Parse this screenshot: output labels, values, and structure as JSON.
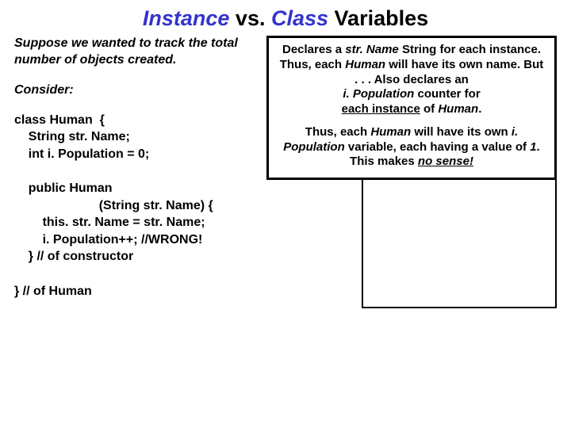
{
  "title": {
    "instance": "Instance",
    "vs": " vs. ",
    "class": "Class",
    "variables": " Variables"
  },
  "left": {
    "intro": "Suppose we wanted to track the total number of objects created.",
    "consider": "Consider:",
    "code": "class Human  {\n    String str. Name;\n    int i. Population = 0;\n\n    public Human\n                        (String str. Name) {\n        this. str. Name = str. Name;\n        i. Population++; //WRONG!\n    } // of constructor\n\n} // of Human"
  },
  "box": {
    "p1_a": "Declares a ",
    "p1_b": "str. Name",
    "p1_c": " String for each instance.  Thus, each ",
    "p1_d": "Human",
    "p1_e": " will have its own name.  But . . . Also declares an",
    "p1_f": "i. Population",
    "p1_g": " counter for",
    "p1_h": "each instance",
    "p1_i": " of ",
    "p1_j": "Human",
    "p1_k": ".",
    "p2_a": "Thus, each ",
    "p2_b": "Human",
    "p2_c": " will have its own ",
    "p2_d": "i. Population",
    "p2_e": " variable, each having a value of ",
    "p2_f": "1",
    "p2_g": ".    This makes ",
    "p2_h": "no sense!"
  }
}
